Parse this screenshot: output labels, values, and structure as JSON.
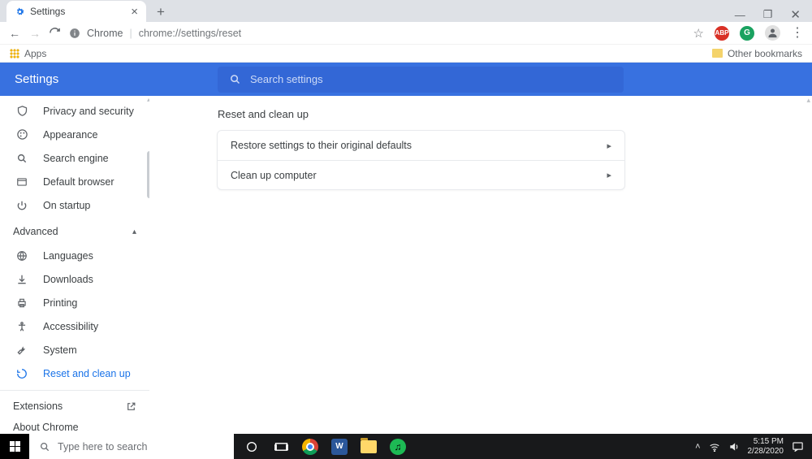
{
  "tab": {
    "title": "Settings"
  },
  "omnibox": {
    "chip": "Chrome",
    "url": "chrome://settings/reset"
  },
  "bookmarks": {
    "apps": "Apps",
    "other": "Other bookmarks"
  },
  "header": {
    "title": "Settings"
  },
  "search": {
    "placeholder": "Search settings"
  },
  "sidebar": {
    "basic": [
      {
        "label": "Privacy and security"
      },
      {
        "label": "Appearance"
      },
      {
        "label": "Search engine"
      },
      {
        "label": "Default browser"
      },
      {
        "label": "On startup"
      }
    ],
    "advanced_label": "Advanced",
    "advanced": [
      {
        "label": "Languages"
      },
      {
        "label": "Downloads"
      },
      {
        "label": "Printing"
      },
      {
        "label": "Accessibility"
      },
      {
        "label": "System"
      },
      {
        "label": "Reset and clean up"
      }
    ],
    "footer": [
      {
        "label": "Extensions"
      },
      {
        "label": "About Chrome"
      }
    ]
  },
  "main": {
    "section_title": "Reset and clean up",
    "rows": [
      {
        "label": "Restore settings to their original defaults"
      },
      {
        "label": "Clean up computer"
      }
    ]
  },
  "taskbar": {
    "search_placeholder": "Type here to search",
    "time": "5:15 PM",
    "date": "2/28/2020"
  }
}
